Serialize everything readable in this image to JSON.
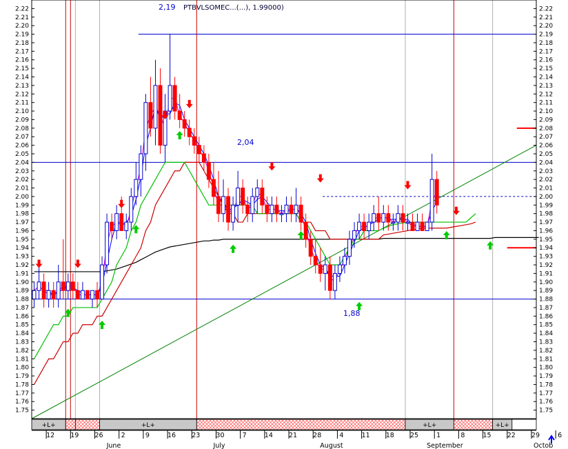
{
  "header": {
    "title": "PTBVLSOMEC...(...), 1.99000)",
    "annot_high": "2,19",
    "annot_mid": "2,04",
    "annot_low": "1,88"
  },
  "colors": {
    "background": "#ffffff",
    "frame": "#000000",
    "hline": "#0000cc",
    "candle_up": "#0000cc",
    "candle_down": "#ff0000",
    "ma_fast": "#0000ff",
    "ma_purple": "#cc00cc",
    "ma_green": "#00c000",
    "ma_red": "#cc0000",
    "ma_black": "#000000",
    "trendline": "#008000",
    "arrow_buy": "#00cc00",
    "arrow_sell": "#ff0000",
    "event_line": "#cc0000",
    "strip_hatch": "#ff6666",
    "strip_grey": "#c8c8c8",
    "nav_arrow": "#0000ff"
  },
  "navigation": {
    "arrow_icon": "up-arrow-icon"
  },
  "chart_data": {
    "type": "candlestick",
    "ylim": [
      1.74,
      2.23
    ],
    "yticks": [
      1.75,
      1.76,
      1.77,
      1.78,
      1.79,
      1.8,
      1.81,
      1.82,
      1.83,
      1.84,
      1.85,
      1.86,
      1.87,
      1.88,
      1.89,
      1.9,
      1.91,
      1.92,
      1.93,
      1.94,
      1.95,
      1.96,
      1.97,
      1.98,
      1.99,
      2.0,
      2.01,
      2.02,
      2.03,
      2.04,
      2.05,
      2.06,
      2.07,
      2.08,
      2.09,
      2.1,
      2.11,
      2.12,
      2.13,
      2.14,
      2.15,
      2.16,
      2.17,
      2.18,
      2.19,
      2.2,
      2.21,
      2.22
    ],
    "xlim": [
      0,
      104
    ],
    "xticks": [
      {
        "i": 3,
        "label": "12"
      },
      {
        "i": 8,
        "label": "19"
      },
      {
        "i": 13,
        "label": "26"
      },
      {
        "i": 18,
        "label": "2"
      },
      {
        "i": 23,
        "label": "9"
      },
      {
        "i": 28,
        "label": "16"
      },
      {
        "i": 33,
        "label": "23"
      },
      {
        "i": 38,
        "label": "30"
      },
      {
        "i": 43,
        "label": "7"
      },
      {
        "i": 48,
        "label": "14"
      },
      {
        "i": 53,
        "label": "21"
      },
      {
        "i": 58,
        "label": "28"
      },
      {
        "i": 63,
        "label": "4"
      },
      {
        "i": 68,
        "label": "11"
      },
      {
        "i": 73,
        "label": "18"
      },
      {
        "i": 78,
        "label": "25"
      },
      {
        "i": 83,
        "label": "1"
      },
      {
        "i": 88,
        "label": "8"
      },
      {
        "i": 93,
        "label": "15"
      },
      {
        "i": 98,
        "label": "22"
      },
      {
        "i": 103,
        "label": "29"
      },
      {
        "i": 108,
        "label": "6"
      }
    ],
    "months": [
      {
        "i": 16,
        "label": "June"
      },
      {
        "i": 38,
        "label": "July"
      },
      {
        "i": 60,
        "label": "August"
      },
      {
        "i": 82,
        "label": "September"
      },
      {
        "i": 104,
        "label": "Octob"
      }
    ],
    "candles": [
      [
        1.88,
        1.9,
        1.87,
        1.89
      ],
      [
        1.89,
        1.92,
        1.88,
        1.9
      ],
      [
        1.9,
        1.91,
        1.87,
        1.88
      ],
      [
        1.88,
        1.9,
        1.87,
        1.89
      ],
      [
        1.89,
        1.9,
        1.87,
        1.88
      ],
      [
        1.88,
        1.92,
        1.87,
        1.9
      ],
      [
        1.9,
        1.95,
        1.88,
        1.89
      ],
      [
        1.89,
        1.91,
        1.88,
        1.9
      ],
      [
        1.9,
        1.91,
        1.88,
        1.89
      ],
      [
        1.89,
        1.9,
        1.88,
        1.88
      ],
      [
        1.88,
        1.9,
        1.88,
        1.89
      ],
      [
        1.89,
        1.89,
        1.88,
        1.88
      ],
      [
        1.88,
        1.89,
        1.87,
        1.89
      ],
      [
        1.89,
        1.9,
        1.87,
        1.88
      ],
      [
        1.88,
        1.93,
        1.88,
        1.92
      ],
      [
        1.92,
        1.98,
        1.91,
        1.97
      ],
      [
        1.97,
        1.98,
        1.95,
        1.96
      ],
      [
        1.96,
        1.99,
        1.95,
        1.98
      ],
      [
        1.98,
        2.0,
        1.96,
        1.96
      ],
      [
        1.96,
        1.98,
        1.95,
        1.97
      ],
      [
        1.97,
        2.01,
        1.96,
        2.0
      ],
      [
        2.0,
        2.04,
        1.99,
        2.02
      ],
      [
        2.02,
        2.06,
        2.0,
        2.05
      ],
      [
        2.05,
        2.12,
        2.03,
        2.11
      ],
      [
        2.11,
        2.14,
        2.07,
        2.08
      ],
      [
        2.08,
        2.16,
        2.06,
        2.13
      ],
      [
        2.13,
        2.15,
        2.05,
        2.06
      ],
      [
        2.06,
        2.12,
        2.04,
        2.1
      ],
      [
        2.1,
        2.19,
        2.09,
        2.13
      ],
      [
        2.13,
        2.14,
        2.09,
        2.1
      ],
      [
        2.1,
        2.12,
        2.08,
        2.09
      ],
      [
        2.09,
        2.1,
        2.07,
        2.08
      ],
      [
        2.08,
        2.09,
        2.06,
        2.07
      ],
      [
        2.07,
        2.08,
        2.05,
        2.06
      ],
      [
        2.06,
        2.07,
        2.04,
        2.05
      ],
      [
        2.05,
        2.06,
        2.03,
        2.04
      ],
      [
        2.04,
        2.05,
        2.01,
        2.02
      ],
      [
        2.02,
        2.04,
        1.99,
        2.0
      ],
      [
        2.0,
        2.03,
        1.97,
        1.98
      ],
      [
        1.98,
        2.02,
        1.97,
        2.0
      ],
      [
        2.0,
        2.01,
        1.96,
        1.97
      ],
      [
        1.97,
        2.0,
        1.96,
        1.99
      ],
      [
        1.99,
        2.03,
        1.97,
        2.01
      ],
      [
        2.01,
        2.02,
        1.98,
        1.99
      ],
      [
        1.99,
        2.0,
        1.97,
        1.98
      ],
      [
        1.98,
        2.01,
        1.97,
        2.0
      ],
      [
        2.0,
        2.02,
        1.98,
        2.01
      ],
      [
        2.01,
        2.02,
        1.98,
        1.99
      ],
      [
        1.99,
        2.0,
        1.97,
        1.98
      ],
      [
        1.98,
        2.0,
        1.97,
        1.99
      ],
      [
        1.99,
        2.0,
        1.97,
        1.98
      ],
      [
        1.98,
        1.99,
        1.97,
        1.98
      ],
      [
        1.98,
        2.0,
        1.97,
        1.99
      ],
      [
        1.99,
        2.0,
        1.97,
        1.98
      ],
      [
        1.98,
        2.01,
        1.97,
        1.99
      ],
      [
        1.99,
        2.0,
        1.96,
        1.97
      ],
      [
        1.97,
        1.98,
        1.94,
        1.95
      ],
      [
        1.95,
        1.96,
        1.92,
        1.93
      ],
      [
        1.93,
        1.95,
        1.91,
        1.92
      ],
      [
        1.92,
        1.94,
        1.9,
        1.91
      ],
      [
        1.91,
        1.93,
        1.89,
        1.92
      ],
      [
        1.92,
        1.93,
        1.88,
        1.89
      ],
      [
        1.89,
        1.92,
        1.88,
        1.91
      ],
      [
        1.91,
        1.93,
        1.9,
        1.92
      ],
      [
        1.92,
        1.94,
        1.91,
        1.93
      ],
      [
        1.93,
        1.96,
        1.92,
        1.95
      ],
      [
        1.95,
        1.97,
        1.94,
        1.96
      ],
      [
        1.96,
        1.98,
        1.95,
        1.97
      ],
      [
        1.97,
        1.98,
        1.95,
        1.96
      ],
      [
        1.96,
        1.98,
        1.95,
        1.97
      ],
      [
        1.97,
        1.99,
        1.96,
        1.98
      ],
      [
        1.98,
        2.0,
        1.96,
        1.97
      ],
      [
        1.97,
        1.99,
        1.96,
        1.98
      ],
      [
        1.98,
        1.99,
        1.96,
        1.97
      ],
      [
        1.97,
        1.98,
        1.96,
        1.97
      ],
      [
        1.97,
        1.99,
        1.96,
        1.98
      ],
      [
        1.98,
        1.99,
        1.96,
        1.97
      ],
      [
        1.97,
        1.98,
        1.96,
        1.97
      ],
      [
        1.97,
        1.98,
        1.96,
        1.96
      ],
      [
        1.96,
        1.98,
        1.96,
        1.97
      ],
      [
        1.97,
        1.98,
        1.96,
        1.96
      ],
      [
        1.96,
        1.97,
        1.96,
        1.97
      ],
      [
        1.97,
        2.05,
        1.96,
        2.02
      ],
      [
        2.02,
        2.03,
        1.98,
        1.99
      ]
    ],
    "signals": [
      {
        "i": 1,
        "dir": "down",
        "y": 1.918
      },
      {
        "i": 9,
        "dir": "down",
        "y": 1.918
      },
      {
        "i": 18,
        "dir": "down",
        "y": 1.988
      },
      {
        "i": 21,
        "dir": "up",
        "y": 1.965
      },
      {
        "i": 27,
        "dir": "down",
        "y": 2.092
      },
      {
        "i": 32,
        "dir": "down",
        "y": 2.105
      },
      {
        "i": 30,
        "dir": "up",
        "y": 2.075
      },
      {
        "i": 7,
        "dir": "up",
        "y": 1.867
      },
      {
        "i": 14,
        "dir": "up",
        "y": 1.853
      },
      {
        "i": 41,
        "dir": "up",
        "y": 1.942
      },
      {
        "i": 49,
        "dir": "down",
        "y": 2.032
      },
      {
        "i": 55,
        "dir": "up",
        "y": 1.958
      },
      {
        "i": 59,
        "dir": "down",
        "y": 2.018
      },
      {
        "i": 67,
        "dir": "up",
        "y": 1.875
      },
      {
        "i": 77,
        "dir": "down",
        "y": 2.01
      },
      {
        "i": 85,
        "dir": "up",
        "y": 1.958
      },
      {
        "i": 87,
        "dir": "down",
        "y": 1.98
      },
      {
        "i": 94,
        "dir": "up",
        "y": 1.946
      }
    ],
    "hlines": [
      2.19,
      2.04,
      1.88
    ],
    "dashed_line": 2.0,
    "resistance_segments": [
      {
        "x1": 100,
        "x2": 112,
        "y": 2.08
      },
      {
        "x1": 98,
        "x2": 112,
        "y": 1.94
      }
    ],
    "trendline": {
      "x1": 0,
      "y1": 1.74,
      "x2": 112,
      "y2": 2.06
    },
    "vlines_red": [
      7,
      8,
      34,
      87
    ],
    "vlines_grey": [
      9,
      14,
      77,
      95
    ],
    "strip": [
      {
        "x1": 0,
        "x2": 7,
        "label": "+L+",
        "kind": "grey"
      },
      {
        "x1": 7,
        "x2": 9,
        "label": "",
        "kind": "hatch"
      },
      {
        "x1": 9,
        "x2": 14,
        "label": "",
        "kind": "hatch"
      },
      {
        "x1": 14,
        "x2": 34,
        "label": "+L+",
        "kind": "grey"
      },
      {
        "x1": 34,
        "x2": 77,
        "label": "",
        "kind": "hatch"
      },
      {
        "x1": 77,
        "x2": 87,
        "label": "+L+",
        "kind": "grey"
      },
      {
        "x1": 87,
        "x2": 95,
        "label": "",
        "kind": "hatch"
      },
      {
        "x1": 95,
        "x2": 99,
        "label": "+L+",
        "kind": "grey"
      },
      {
        "x1": 99,
        "x2": 112,
        "label": "",
        "kind": "white"
      }
    ],
    "ma_series": [
      {
        "color": "ma_black",
        "values": [
          1.912,
          1.912,
          1.912,
          1.912,
          1.912,
          1.912,
          1.912,
          1.912,
          1.912,
          1.912,
          1.912,
          1.912,
          1.912,
          1.912,
          1.912,
          1.913,
          1.914,
          1.915,
          1.917,
          1.919,
          1.921,
          1.923,
          1.926,
          1.929,
          1.932,
          1.935,
          1.937,
          1.939,
          1.941,
          1.942,
          1.943,
          1.944,
          1.945,
          1.946,
          1.947,
          1.948,
          1.948,
          1.949,
          1.949,
          1.95,
          1.95,
          1.95,
          1.95,
          1.95,
          1.95,
          1.95,
          1.95,
          1.95,
          1.95,
          1.95,
          1.95,
          1.95,
          1.95,
          1.95,
          1.95,
          1.95,
          1.95,
          1.95,
          1.95,
          1.95,
          1.95,
          1.95,
          1.95,
          1.95,
          1.95,
          1.95,
          1.95,
          1.95,
          1.95,
          1.95,
          1.95,
          1.95,
          1.951,
          1.951,
          1.951,
          1.951,
          1.951,
          1.951,
          1.951,
          1.951,
          1.951,
          1.951,
          1.951,
          1.951,
          1.951,
          1.951,
          1.951,
          1.951,
          1.951,
          1.951,
          1.951,
          1.951,
          1.951,
          1.951,
          1.951,
          1.952,
          1.952,
          1.952,
          1.952,
          1.952,
          1.952,
          1.952,
          1.952,
          1.952,
          1.952
        ]
      },
      {
        "color": "ma_red",
        "values": [
          1.78,
          1.79,
          1.8,
          1.81,
          1.81,
          1.82,
          1.83,
          1.83,
          1.84,
          1.84,
          1.85,
          1.85,
          1.85,
          1.86,
          1.86,
          1.87,
          1.88,
          1.89,
          1.9,
          1.91,
          1.92,
          1.93,
          1.94,
          1.96,
          1.97,
          1.99,
          2.0,
          2.01,
          2.02,
          2.03,
          2.03,
          2.04,
          2.04,
          2.04,
          2.04,
          2.03,
          2.02,
          2.01,
          2.0,
          1.99,
          1.98,
          1.98,
          1.97,
          1.97,
          1.98,
          1.98,
          1.98,
          1.98,
          1.98,
          1.98,
          1.98,
          1.98,
          1.98,
          1.98,
          1.98,
          1.97,
          1.97,
          1.97,
          1.96,
          1.96,
          1.96,
          1.95,
          1.95,
          1.95,
          1.95,
          1.95,
          1.95,
          1.95,
          1.95,
          1.95,
          1.95,
          1.95,
          1.955,
          1.956,
          1.957,
          1.958,
          1.959,
          1.96,
          1.961,
          1.962,
          1.963,
          1.963,
          1.963,
          1.963,
          1.963,
          1.963,
          1.964,
          1.965,
          1.966,
          1.967,
          1.968,
          1.97
        ]
      },
      {
        "color": "ma_green",
        "values": [
          1.81,
          1.82,
          1.83,
          1.84,
          1.85,
          1.85,
          1.86,
          1.86,
          1.87,
          1.87,
          1.87,
          1.87,
          1.87,
          1.87,
          1.88,
          1.89,
          1.9,
          1.92,
          1.93,
          1.94,
          1.96,
          1.97,
          1.99,
          2.0,
          2.01,
          2.02,
          2.03,
          2.04,
          2.04,
          2.04,
          2.04,
          2.04,
          2.03,
          2.02,
          2.01,
          2.0,
          1.99,
          1.99,
          1.99,
          1.99,
          1.99,
          1.99,
          1.99,
          1.99,
          1.99,
          1.99,
          1.98,
          1.98,
          1.98,
          1.98,
          1.98,
          1.98,
          1.98,
          1.98,
          1.98,
          1.97,
          1.97,
          1.96,
          1.95,
          1.94,
          1.93,
          1.92,
          1.92,
          1.92,
          1.93,
          1.94,
          1.95,
          1.95,
          1.96,
          1.96,
          1.96,
          1.96,
          1.963,
          1.965,
          1.967,
          1.968,
          1.969,
          1.97,
          1.97,
          1.97,
          1.97,
          1.97,
          1.97,
          1.97,
          1.97,
          1.97,
          1.97,
          1.97,
          1.97,
          1.97,
          1.975,
          1.98
        ]
      }
    ]
  }
}
